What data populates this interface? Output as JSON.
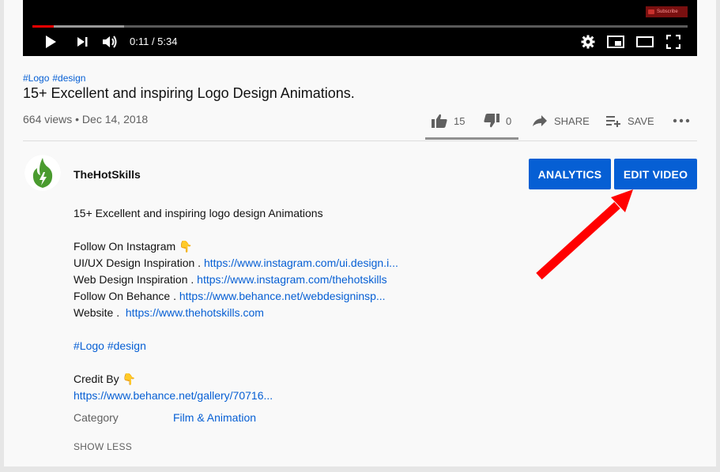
{
  "player": {
    "time": "0:11 / 5:34",
    "subscribe_watermark": "Subscribe",
    "progress_fraction": 0.033,
    "buffer_fraction": 0.14
  },
  "video": {
    "hashtags": [
      "#Logo",
      "#design"
    ],
    "title": "15+ Excellent and inspiring Logo Design Animations.",
    "views_date": "664 views • Dec 14, 2018"
  },
  "actions": {
    "likes": "15",
    "dislikes": "0",
    "share": "SHARE",
    "save": "SAVE"
  },
  "channel": {
    "name": "TheHotSkills",
    "analytics_label": "ANALYTICS",
    "edit_label": "EDIT VIDEO"
  },
  "description": {
    "summary": "15+ Excellent and inspiring logo design Animations",
    "follow_instagram": "Follow On Instagram 👇",
    "uiux_label": "UI/UX Design Inspiration . ",
    "uiux_link": "https://www.instagram.com/ui.design.i...",
    "web_label": "Web Design Inspiration . ",
    "web_link": "https://www.instagram.com/thehotskills",
    "behance_label": "Follow On Behance . ",
    "behance_link": "https://www.behance.net/webdesigninsp...",
    "website_label": "Website .  ",
    "website_link": "https://www.thehotskills.com",
    "hashtags": "#Logo #design",
    "credit_label": "Credit By 👇",
    "credit_link": "https://www.behance.net/gallery/70716...",
    "category_label": "Category",
    "category_value": "Film & Animation",
    "show_less": "SHOW LESS"
  },
  "colors": {
    "link": "#065fd4",
    "button": "#065fd4",
    "annotation_arrow": "#ff0000",
    "avatar_flame": "#4a9b2f"
  }
}
